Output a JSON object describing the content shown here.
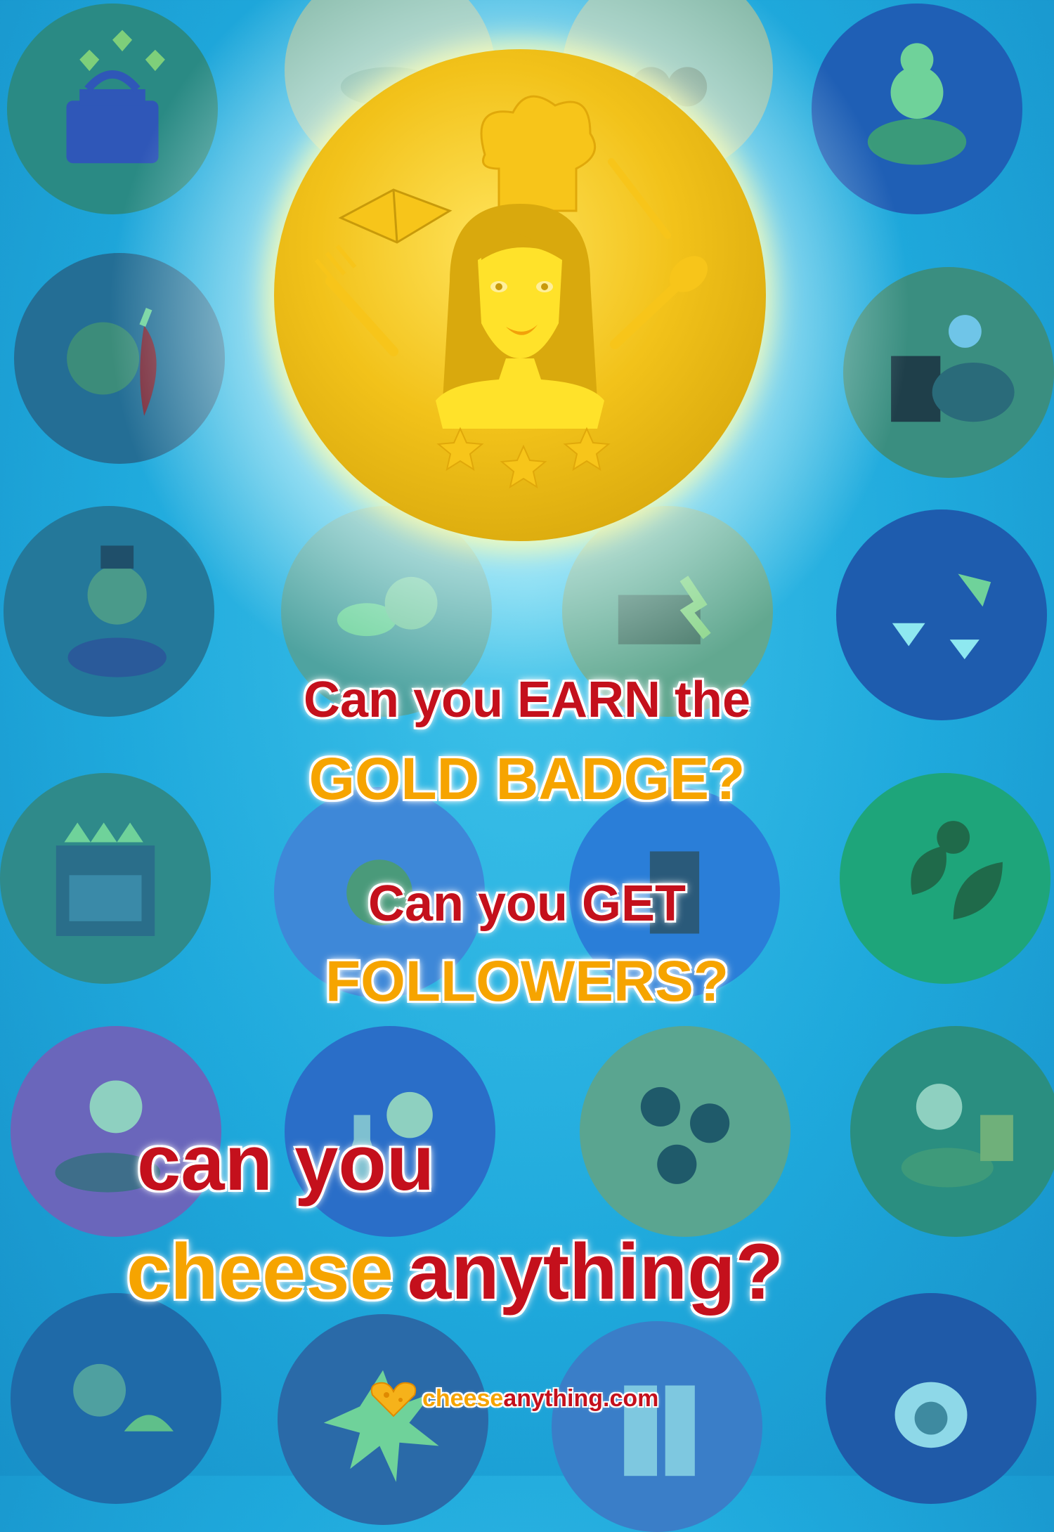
{
  "headlines": {
    "line1": "Can you EARN the",
    "line2": "GOLD BADGE?",
    "line3": "Can you GET",
    "line4": "FOLLOWERS?",
    "line5": "can you",
    "line6_a": "cheese",
    "line6_b": "anything?"
  },
  "logo": {
    "part1": "cheese",
    "part2": "anything",
    "part3": ".com"
  },
  "colors": {
    "red": "#c4101c",
    "orange": "#f6a400",
    "gold": "#f2c21a",
    "background": "#1fa9dc"
  },
  "icons": [
    "teapot-hearts-icon",
    "sushi-icon",
    "snowman-soup-icon",
    "girl-chili-icon",
    "chocolate-pot-icon",
    "chef-pasta-icon",
    "burger-friends-icon",
    "grill-icon",
    "cocktails-icon",
    "stove-icon",
    "leaves-icon",
    "girl-spaghetti-icon",
    "girl-bottle-icon",
    "sushi-rolls-icon",
    "girl-cereal-icon",
    "cook-cloche-icon",
    "starburst-icon",
    "cutting-board-icon",
    "egg-pan-icon",
    "gold-badge-chef-icon",
    "cheese-heart-logo-icon"
  ]
}
